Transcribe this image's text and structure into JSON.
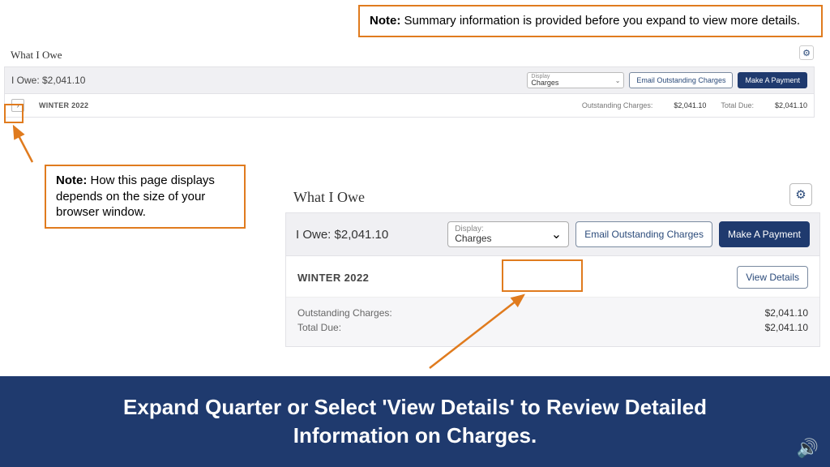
{
  "notes": {
    "top": {
      "prefix": "Note: ",
      "text": "Summary information is provided before you expand to view more details."
    },
    "left": {
      "prefix": "Note: ",
      "text": "How this page displays depends on the size of your browser window."
    }
  },
  "wide_view": {
    "title": "What I Owe",
    "i_owe_label": "I Owe: $2,041.10",
    "display_label": "Display",
    "display_value": "Charges",
    "email_btn": "Email Outstanding Charges",
    "pay_btn": "Make A Payment",
    "term": "WINTER 2022",
    "outstanding_label": "Outstanding Charges:",
    "outstanding_value": "$2,041.10",
    "total_label": "Total Due:",
    "total_value": "$2,041.10",
    "term_display_in_row": "INTER 2022"
  },
  "compact_view": {
    "title": "What I Owe",
    "i_owe_label": "I Owe: $2,041.10",
    "display_label": "Display:",
    "display_value": "Charges",
    "email_btn": "Email Outstanding Charges",
    "pay_btn": "Make A Payment",
    "term": "WINTER 2022",
    "view_details_btn": "View Details",
    "outstanding_label": "Outstanding Charges:",
    "outstanding_value": "$2,041.10",
    "total_label": "Total Due:",
    "total_value": "$2,041.10"
  },
  "banner": {
    "text": "Expand Quarter or Select 'View Details' to Review Detailed Information on Charges."
  }
}
